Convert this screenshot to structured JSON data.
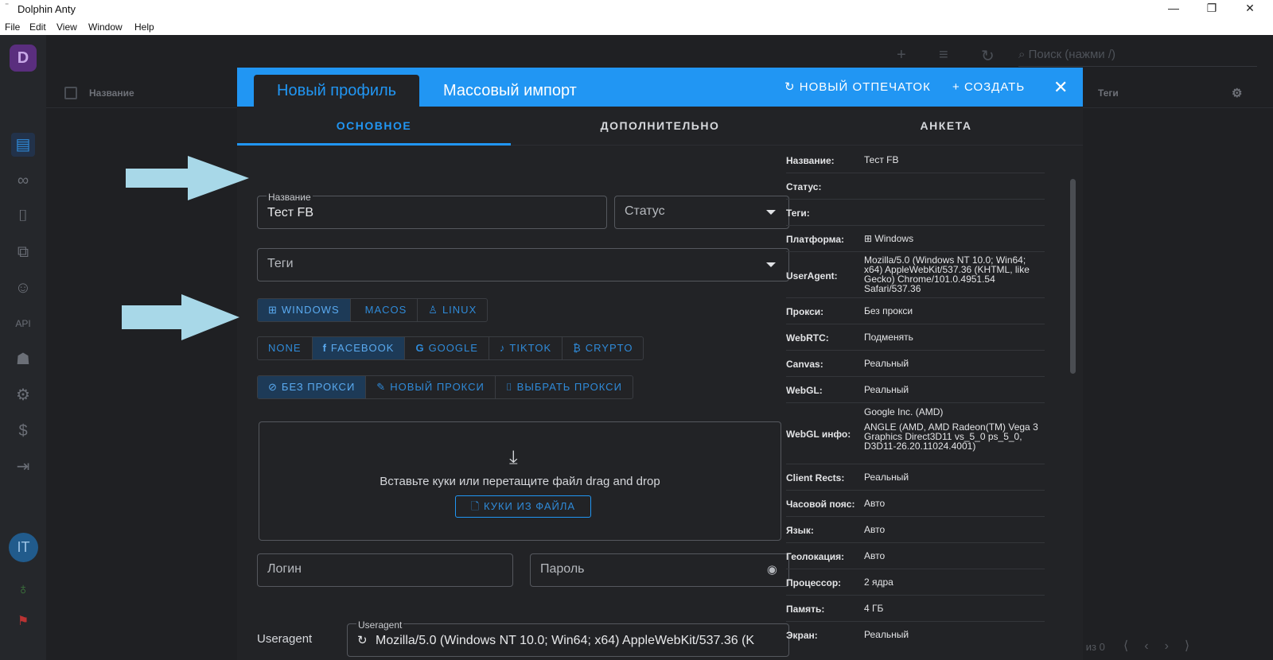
{
  "window": {
    "title": "Dolphin Anty",
    "menu": [
      "File",
      "Edit",
      "View",
      "Window",
      "Help"
    ]
  },
  "background": {
    "col_name": "Название",
    "col_tags": "Теги",
    "search_placeholder": "Поиск (нажми /)",
    "pagination": "- 0 из 0"
  },
  "sidebar": {
    "logo": "D",
    "avatar": "IT"
  },
  "modal": {
    "tabs": [
      "Новый профиль",
      "Массовый импорт"
    ],
    "new_fingerprint": "НОВЫЙ ОТПЕЧАТОК",
    "create": "СОЗДАТЬ",
    "subtabs": [
      "ОСНОВНОЕ",
      "ДОПОЛНИТЕЛЬНО",
      "АНКЕТА"
    ],
    "name_label": "Название",
    "name_value": "Тест FB",
    "status_placeholder": "Статус",
    "tags_placeholder": "Теги",
    "os": [
      "WINDOWS",
      "MACOS",
      "LINUX"
    ],
    "platforms": [
      "NONE",
      "FACEBOOK",
      "GOOGLE",
      "TIKTOK",
      "CRYPTO"
    ],
    "proxy": [
      "БЕЗ ПРОКСИ",
      "НОВЫЙ ПРОКСИ",
      "ВЫБРАТЬ ПРОКСИ"
    ],
    "cookies_text": "Вставьте куки или перетащите файл drag and drop",
    "cookies_button": "КУКИ ИЗ ФАЙЛА",
    "login_placeholder": "Логин",
    "password_placeholder": "Пароль",
    "useragent_label": "Useragent",
    "useragent_field_label": "Useragent",
    "useragent_value": "Mozilla/5.0 (Windows NT 10.0; Win64; x64) AppleWebKit/537.36 (K"
  },
  "summary": [
    {
      "k": "Название:",
      "v": "Тест FB"
    },
    {
      "k": "Статус:",
      "v": ""
    },
    {
      "k": "Теги:",
      "v": ""
    },
    {
      "k": "Платформа:",
      "v": "Windows"
    },
    {
      "k": "UserAgent:",
      "v": "Mozilla/5.0 (Windows NT 10.0; Win64; x64) AppleWebKit/537.36 (KHTML, like Gecko) Chrome/101.0.4951.54 Safari/537.36"
    },
    {
      "k": "Прокси:",
      "v": "Без прокси"
    },
    {
      "k": "WebRTC:",
      "v": "Подменять"
    },
    {
      "k": "Canvas:",
      "v": "Реальный"
    },
    {
      "k": "WebGL:",
      "v": "Реальный"
    },
    {
      "k": "WebGL инфо:",
      "v": "Google Inc. (AMD)",
      "v2": "ANGLE (AMD, AMD Radeon(TM) Vega 3 Graphics Direct3D11 vs_5_0 ps_5_0, D3D11-26.20.11024.4001)"
    },
    {
      "k": "Client Rects:",
      "v": "Реальный"
    },
    {
      "k": "Часовой пояс:",
      "v": "Авто"
    },
    {
      "k": "Язык:",
      "v": "Авто"
    },
    {
      "k": "Геолокация:",
      "v": "Авто"
    },
    {
      "k": "Процессор:",
      "v": "2 ядра"
    },
    {
      "k": "Память:",
      "v": "4 ГБ"
    },
    {
      "k": "Экран:",
      "v": "Реальный"
    }
  ],
  "colors": {
    "accent": "#2196f3",
    "arrow": "#a8d8e8",
    "bg": "#1f2023",
    "modal": "#222326"
  }
}
